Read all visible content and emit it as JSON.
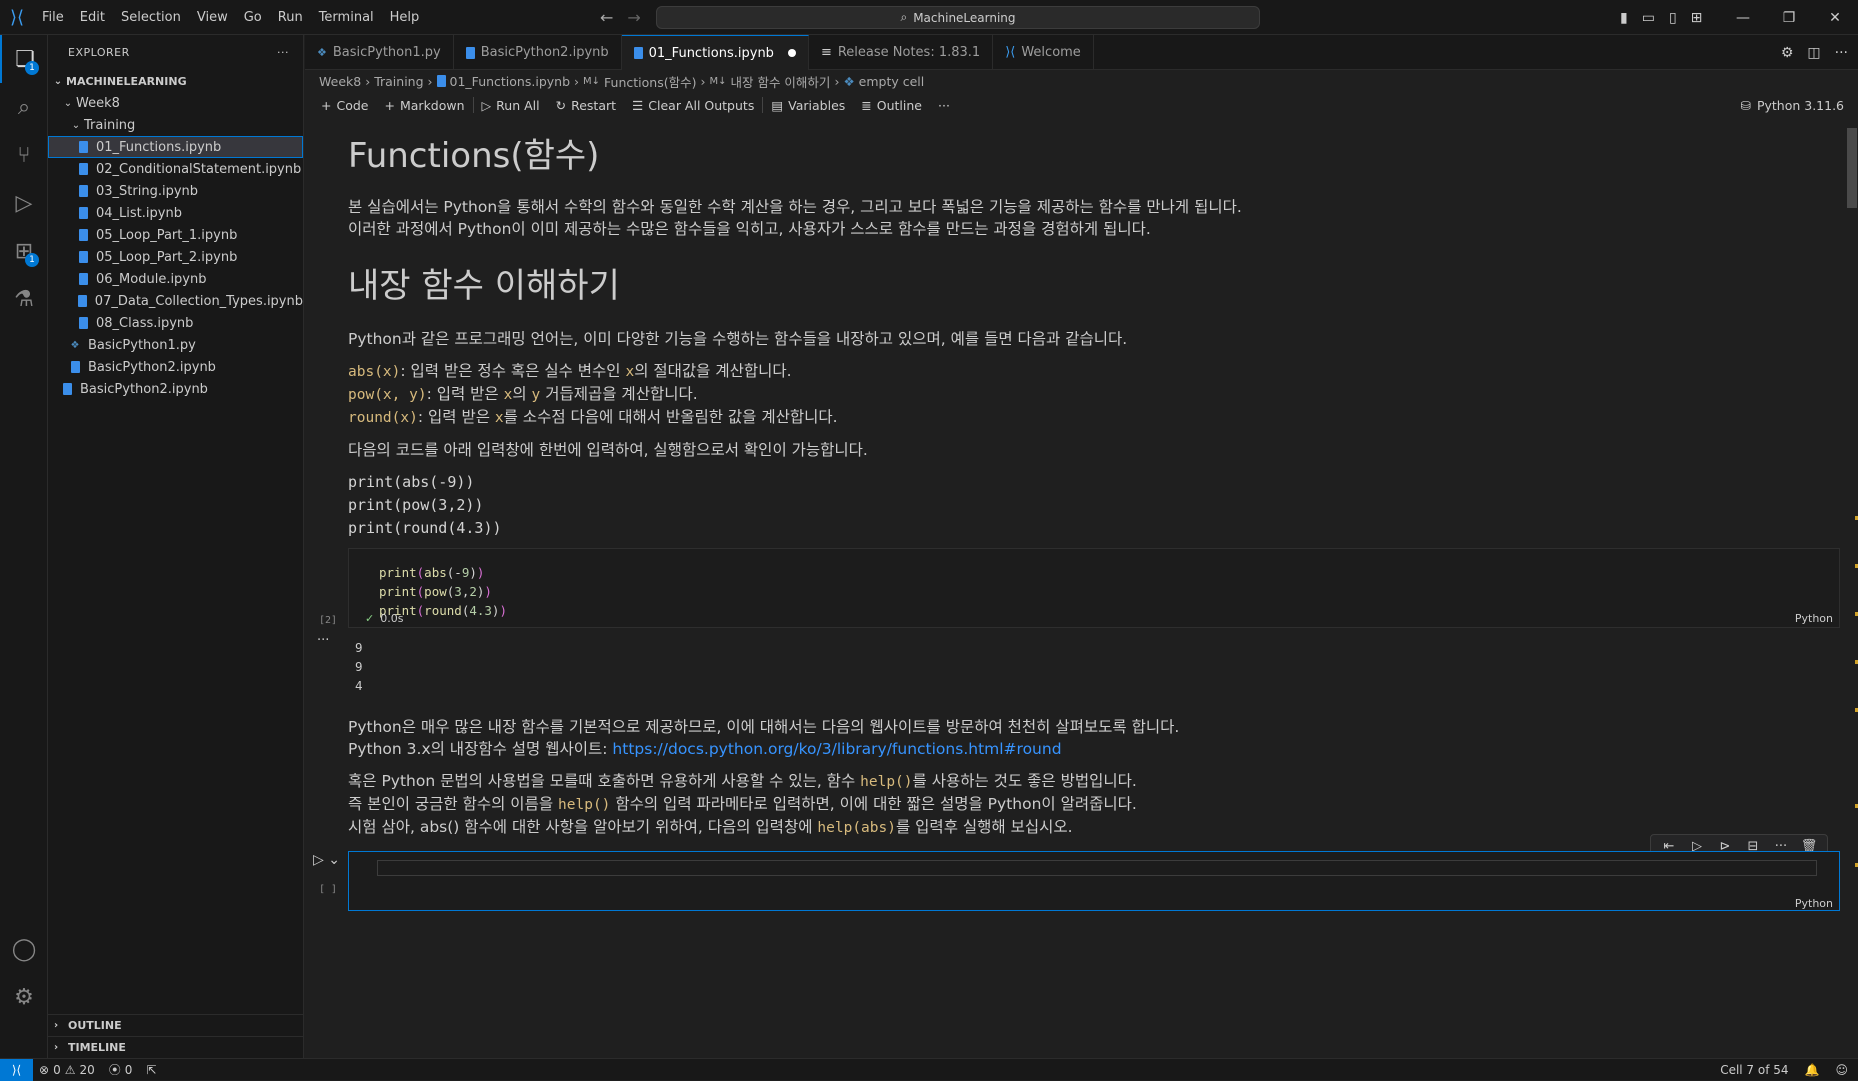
{
  "titlebar": {
    "menu": [
      "File",
      "Edit",
      "Selection",
      "View",
      "Go",
      "Run",
      "Terminal",
      "Help"
    ],
    "search": "MachineLearning"
  },
  "activity": {
    "explorer_badge": "1",
    "extensions_badge": "1"
  },
  "sidebar": {
    "title": "EXPLORER",
    "root": "MACHINELEARNING",
    "folders": [
      "Week8",
      "Training"
    ],
    "files": [
      "01_Functions.ipynb",
      "02_ConditionalStatement.ipynb",
      "03_String.ipynb",
      "04_List.ipynb",
      "05_Loop_Part_1.ipynb",
      "05_Loop_Part_2.ipynb",
      "06_Module.ipynb",
      "07_Data_Collection_Types.ipynb",
      "08_Class.ipynb"
    ],
    "week_files": [
      "BasicPython1.py",
      "BasicPython2.ipynb"
    ],
    "root_files": [
      "BasicPython2.ipynb"
    ],
    "outline": "OUTLINE",
    "timeline": "TIMELINE"
  },
  "tabs": [
    "BasicPython1.py",
    "BasicPython2.ipynb",
    "01_Functions.ipynb",
    "Release Notes: 1.83.1",
    "Welcome"
  ],
  "breadcrumb": [
    "Week8",
    "Training",
    "01_Functions.ipynb",
    "Functions(함수)",
    "내장 함수 이해하기",
    "empty cell"
  ],
  "toolbar": {
    "code": "Code",
    "markdown": "Markdown",
    "run_all": "Run All",
    "restart": "Restart",
    "clear": "Clear All Outputs",
    "variables": "Variables",
    "outline": "Outline",
    "more": "···",
    "kernel": "Python 3.11.6"
  },
  "notebook": {
    "h1": "Functions(함수)",
    "intro1": "본 실습에서는 Python을 통해서 수학의 함수와 동일한 수학 계산을 하는 경우, 그리고 보다 폭넓은 기능을 제공하는 함수를 만나게 됩니다.",
    "intro2": "이러한 과정에서 Python이 이미 제공하는 수많은 함수들을 익히고, 사용자가 스스로 함수를 만드는 과정을 경험하게 됩니다.",
    "h2": "내장 함수 이해하기",
    "p1": "Python과 같은 프로그래밍 언어는, 이미 다양한 기능을 수행하는 함수들을 내장하고 있으며, 예를 들면 다음과 같습니다.",
    "abs_code": "abs(x)",
    "abs_text": ": 입력 받은 정수 혹은 실수 변수인 ",
    "abs_x": "x",
    "abs_tail": "의 절대값을 계산합니다.",
    "pow_code": "pow(x, y)",
    "pow_text": ": 입력 받은 ",
    "pow_x": "x",
    "pow_mid": "의 ",
    "pow_y": "y",
    "pow_tail": " 거듭제곱을 계산합니다.",
    "round_code": "round(x)",
    "round_text": ": 입력 받은 ",
    "round_x": "x",
    "round_tail": "를 소수점 다음에 대해서 반올림한 값을 계산합니다.",
    "p2": "다음의 코드를 아래 입력창에 한번에 입력하여, 실행함으로서 확인이 가능합니다.",
    "md_code": [
      "print(abs(-9))",
      "print(pow(3,2))",
      "print(round(4.3))"
    ],
    "exec_count": "[2]",
    "exec_time": "0.0s",
    "lang": "Python",
    "outputs": [
      "9",
      "9",
      "4"
    ],
    "p3": "Python은 매우 많은 내장 함수를 기본적으로 제공하므로, 이에 대해서는 다음의 웹사이트를 방문하여 천천히 살펴보도록 합니다.",
    "p4_text": "Python 3.x의 내장함수 설명 웹사이트: ",
    "p4_link": "https://docs.python.org/ko/3/library/functions.html#round",
    "p5a": "혹은 Python 문법의 사용법을 모를때 호출하면 유용하게 사용할 수 있는, 함수 ",
    "p5_code": "help()",
    "p5b": "를 사용하는 것도 좋은 방법입니다.",
    "p6a": "즉 본인이 궁금한 함수의 이름을 ",
    "p6_code": "help()",
    "p6b": " 함수의 입력 파라메타로 입력하면, 이에 대한 짧은 설명을 Python이 알려줍니다.",
    "p7a": "시험 삼아, abs() 함수에 대한 사항을 알아보기 위하여, 다음의 입력창에 ",
    "p7_code": "help(abs)",
    "p7b": "를 입력후 실행해 보십시오.",
    "empty_count": "[ ]",
    "empty_lang": "Python"
  },
  "status": {
    "errors": "0",
    "warnings": "20",
    "ports": "0",
    "cell": "Cell 7 of 54"
  }
}
